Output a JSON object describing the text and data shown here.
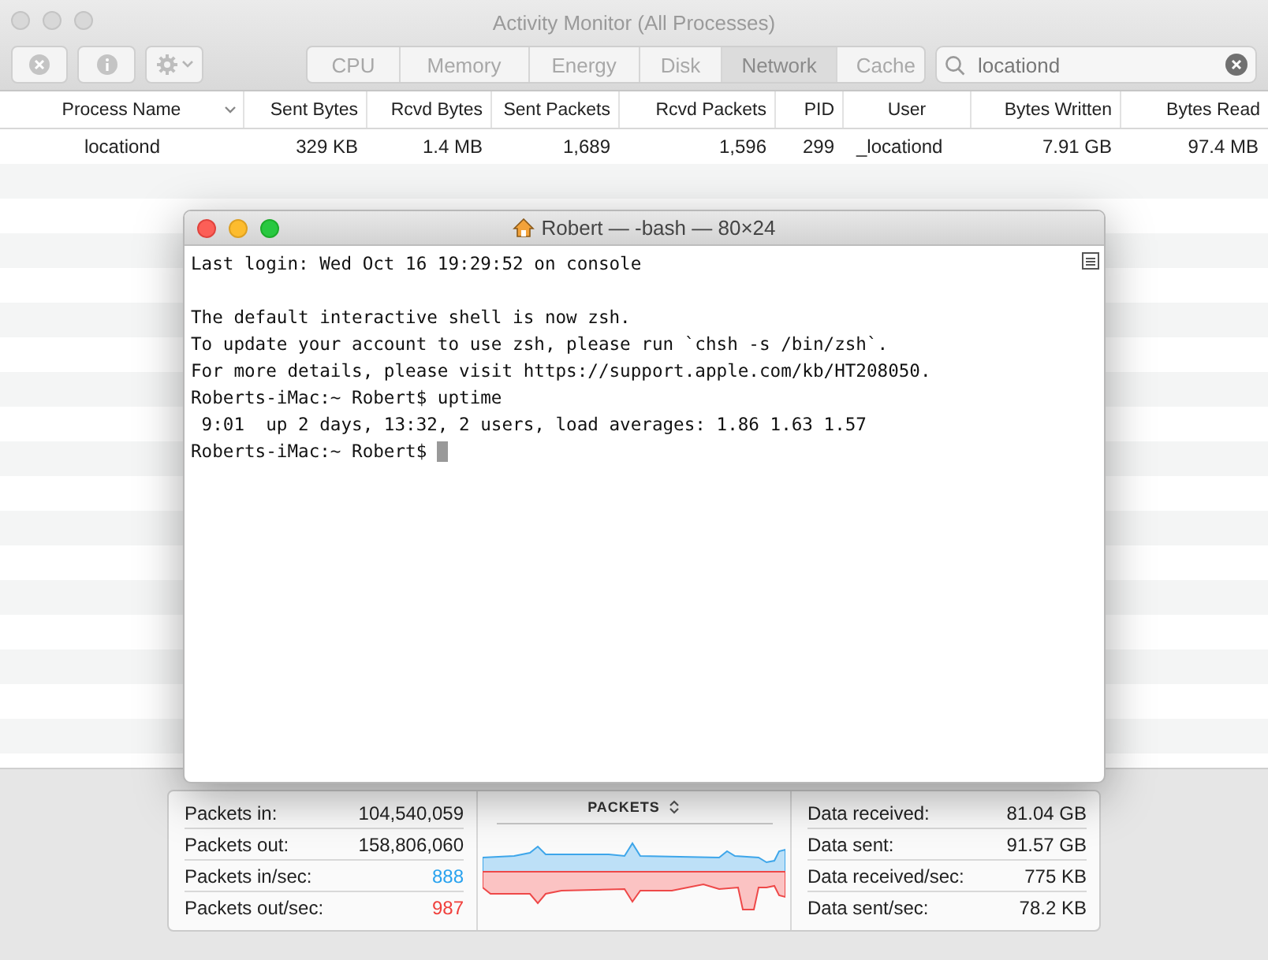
{
  "window": {
    "title": "Activity Monitor (All Processes)"
  },
  "toolbar": {
    "tabs": [
      {
        "label": "CPU",
        "selected": false
      },
      {
        "label": "Memory",
        "selected": false
      },
      {
        "label": "Energy",
        "selected": false
      },
      {
        "label": "Disk",
        "selected": false
      },
      {
        "label": "Network",
        "selected": true
      },
      {
        "label": "Cache",
        "selected": false
      }
    ],
    "search": {
      "value": "locationd"
    }
  },
  "table": {
    "columns": [
      {
        "label": "Process Name",
        "sorted": true
      },
      {
        "label": "Sent Bytes",
        "sorted": false
      },
      {
        "label": "Rcvd Bytes",
        "sorted": false
      },
      {
        "label": "Sent Packets",
        "sorted": false
      },
      {
        "label": "Rcvd Packets",
        "sorted": false
      },
      {
        "label": "PID",
        "sorted": false
      },
      {
        "label": "User",
        "sorted": false
      },
      {
        "label": "Bytes Written",
        "sorted": false
      },
      {
        "label": "Bytes Read",
        "sorted": false
      }
    ],
    "rows": [
      [
        "locationd",
        "329 KB",
        "1.4 MB",
        "1,689",
        "1,596",
        "299",
        "_locationd",
        "7.91 GB",
        "97.4 MB"
      ]
    ]
  },
  "terminal": {
    "title": "Robert — -bash — 80×24",
    "blocks": [
      [
        "Last login: Wed Oct 16 19:29:52 on console"
      ],
      [
        "The default interactive shell is now zsh.",
        "To update your account to use zsh, please run `chsh -s /bin/zsh`.",
        "For more details, please visit https://support.apple.com/kb/HT208050.",
        "Roberts-iMac:~ Robert$ uptime",
        " 9:01  up 2 days, 13:32, 2 users, load averages: 1.86 1.63 1.57",
        "Roberts-iMac:~ Robert$ "
      ]
    ]
  },
  "stats": {
    "left": [
      {
        "label": "Packets in:",
        "value": "104,540,059"
      },
      {
        "label": "Packets out:",
        "value": "158,806,060"
      },
      {
        "label": "Packets in/sec:",
        "value": "888",
        "color": "#2aa3ef"
      },
      {
        "label": "Packets out/sec:",
        "value": "987",
        "color": "#f0403c"
      }
    ],
    "chart_title": "PACKETS",
    "right": [
      {
        "label": "Data received:",
        "value": "81.04 GB"
      },
      {
        "label": "Data sent:",
        "value": "91.57 GB"
      },
      {
        "label": "Data received/sec:",
        "value": "775 KB"
      },
      {
        "label": "Data sent/sec:",
        "value": "78.2 KB"
      }
    ]
  }
}
